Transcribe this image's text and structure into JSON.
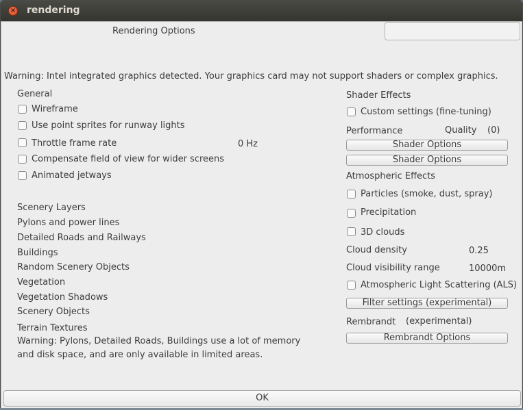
{
  "window": {
    "title": "rendering",
    "close_symbol": "×"
  },
  "header": {
    "title": "Rendering Options",
    "text_field_value": ""
  },
  "warning_top": "Warning: Intel integrated graphics detected.  Your graphics card may not support shaders or complex graphics.",
  "general": {
    "heading": "General",
    "options": [
      {
        "label": "Wireframe",
        "checked": false
      },
      {
        "label": "Use point sprites for runway lights",
        "checked": false
      },
      {
        "label": "Throttle frame rate",
        "checked": false
      },
      {
        "label": "Compensate field of view for wider screens",
        "checked": false
      },
      {
        "label": "Animated jetways",
        "checked": false
      }
    ],
    "frame_rate_value": "0 Hz"
  },
  "scenery": {
    "heading": "Scenery Layers",
    "items": [
      "Pylons and power lines",
      "Detailed Roads and Railways",
      "Buildings",
      "Random Scenery Objects",
      "Vegetation",
      "Vegetation Shadows",
      "Scenery Objects",
      "Terrain Textures"
    ],
    "warning_line1": "Warning: Pylons, Detailed Roads, Buildings use a lot of memory",
    "warning_line2": "and disk space, and are only available in limited areas."
  },
  "shader": {
    "heading": "Shader Effects",
    "custom_label": "Custom settings (fine-tuning)",
    "custom_checked": false,
    "performance_label": "Performance",
    "quality_label": "Quality",
    "quality_value": "(0)",
    "button1": "Shader Options",
    "button2": "Shader Options"
  },
  "atmospheric": {
    "heading": "Atmospheric Effects",
    "particles": "Particles (smoke, dust, spray)",
    "precipitation": "Precipitation",
    "clouds3d": "3D clouds",
    "cloud_density_label": "Cloud density",
    "cloud_density_value": "0.25",
    "cloud_visibility_label": "Cloud visibility range",
    "cloud_visibility_value": "10000m",
    "als": "Atmospheric Light Scattering (ALS)",
    "filter_button": "Filter settings (experimental)"
  },
  "rembrandt": {
    "label": "Rembrandt",
    "experimental": "(experimental)",
    "button": "Rembrandt Options"
  },
  "footer": {
    "ok_label": "OK"
  }
}
